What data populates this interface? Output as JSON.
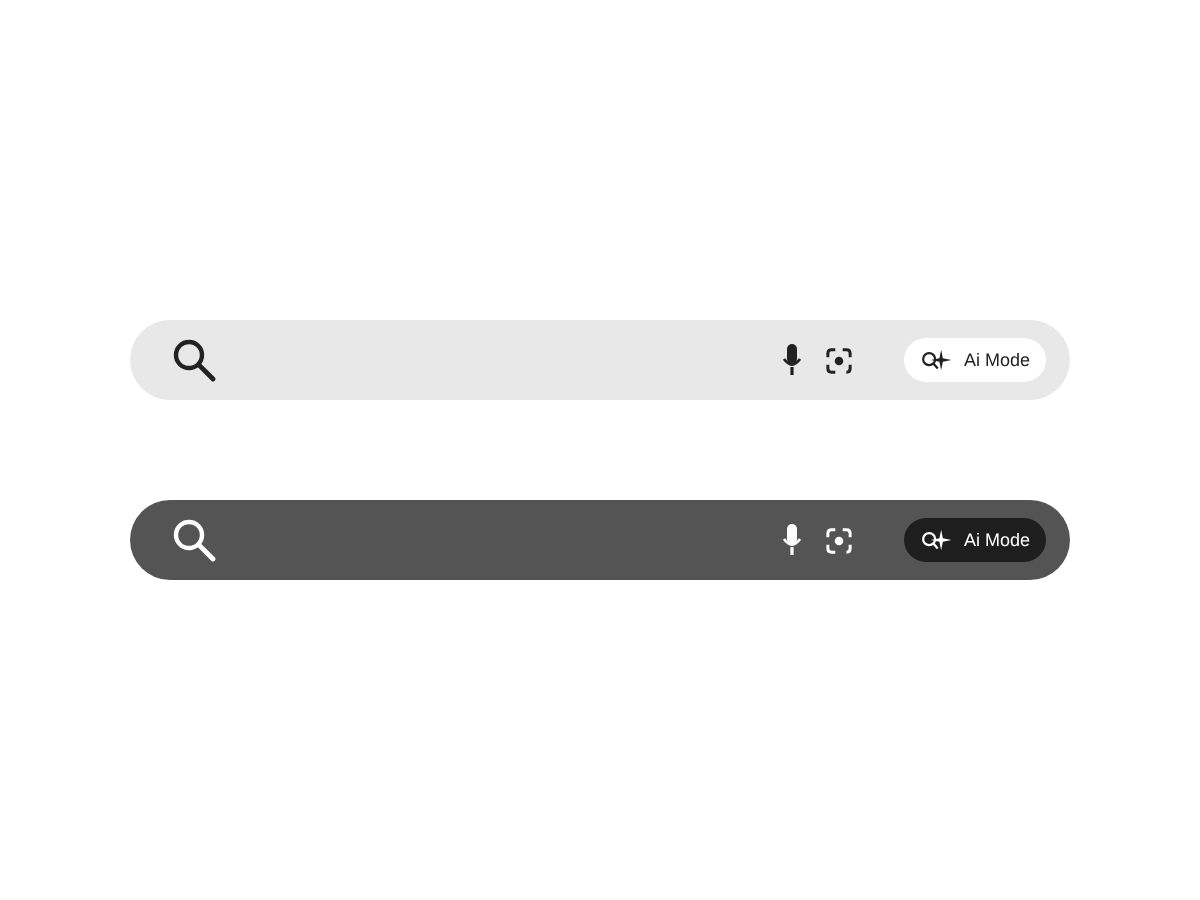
{
  "search_bars": [
    {
      "dark": false,
      "ai_mode_label": "Ai Mode"
    },
    {
      "dark": true,
      "ai_mode_label": "Ai Mode"
    }
  ]
}
